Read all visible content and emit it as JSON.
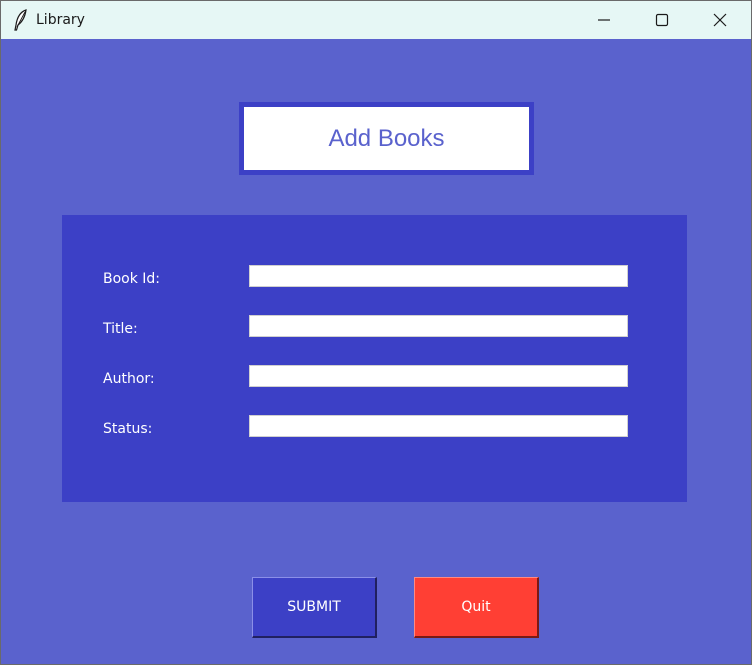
{
  "window": {
    "title": "Library",
    "app_icon": "feather-icon",
    "controls": {
      "minimize_icon": "minimize-icon",
      "maximize_icon": "maximize-icon",
      "close_icon": "close-icon"
    }
  },
  "heading": {
    "text": "Add Books"
  },
  "form": {
    "fields": [
      {
        "label": "Book Id:",
        "value": ""
      },
      {
        "label": "Title:",
        "value": ""
      },
      {
        "label": "Author:",
        "value": ""
      },
      {
        "label": "Status:",
        "value": ""
      }
    ]
  },
  "buttons": {
    "submit_label": "SUBMIT",
    "quit_label": "Quit"
  },
  "colors": {
    "background": "#5a62cd",
    "panel": "#3c40c6",
    "quit": "#ff3f34",
    "titlebar": "#e6f7f5"
  }
}
